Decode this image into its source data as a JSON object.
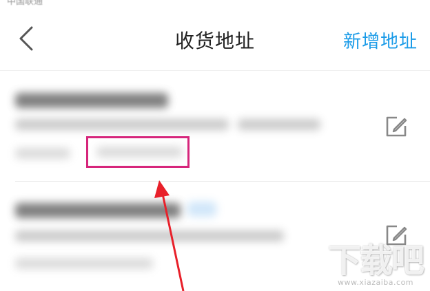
{
  "status_bar": {
    "text": "中国联通"
  },
  "nav": {
    "back_icon": "chevron-left-icon",
    "title": "收货地址",
    "add_label": "新增地址",
    "accent": "#1a9be8"
  },
  "addresses": [
    {
      "edit_icon": "edit-icon"
    },
    {
      "edit_icon": "edit-icon"
    }
  ],
  "annotation": {
    "highlight_color": "#d6257b",
    "arrow_color": "#e8202a"
  },
  "watermark": {
    "text": "下载吧",
    "url": "www.xiazaiba.com"
  }
}
